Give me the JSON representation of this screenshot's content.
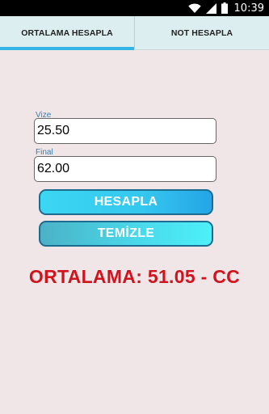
{
  "status_bar": {
    "time": "10:39",
    "icons": [
      "wifi-icon",
      "signal-icon",
      "battery-icon"
    ]
  },
  "tabs": [
    {
      "label": "ORTALAMA HESAPLA",
      "active": true
    },
    {
      "label": "NOT HESAPLA",
      "active": false
    }
  ],
  "form": {
    "vize": {
      "label": "Vize",
      "value": "25.50"
    },
    "final": {
      "label": "Final",
      "value": "62.00"
    }
  },
  "buttons": {
    "calculate": "HESAPLA",
    "clear": "TEMİZLE"
  },
  "result": {
    "text": "ORTALAMA: 51.05 - CC"
  },
  "colors": {
    "accent": "#33b5e5",
    "result": "#d0131c",
    "background": "#f0e6e8",
    "label": "#3a7fa8"
  }
}
